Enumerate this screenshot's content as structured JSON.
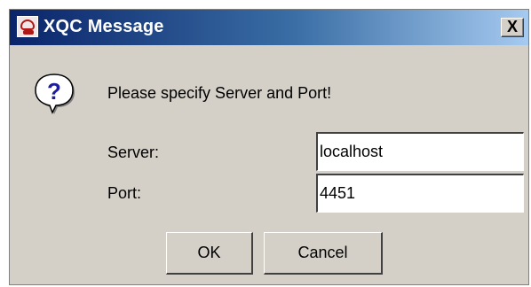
{
  "window": {
    "title": "XQC Message",
    "app_icon": "xqc-app-icon",
    "close_label": "X"
  },
  "message": {
    "icon": "question-icon",
    "text": "Please specify Server and Port!"
  },
  "fields": {
    "server_label": "Server:",
    "server_value": "localhost",
    "port_label": "Port:",
    "port_value": "4451"
  },
  "buttons": {
    "ok_label": "OK",
    "cancel_label": "Cancel"
  },
  "colors": {
    "titlebar_start": "#0a246a",
    "titlebar_end": "#a6caf0",
    "dialog_bg": "#d4d0c8"
  }
}
